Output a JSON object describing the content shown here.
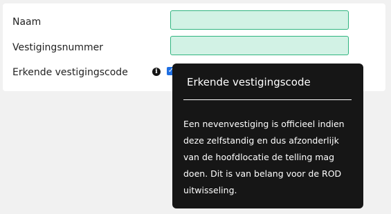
{
  "form": {
    "name_label": "Naam",
    "name_value": "",
    "branch_number_label": "Vestigingsnummer",
    "branch_number_value": "",
    "recognized_code_label": "Erkende vestigingscode",
    "recognized_code_checked": true
  },
  "tooltip": {
    "title": "Erkende vestigingscode",
    "body_lines": [
      "Een nevenvestiging is officieel indien",
      "deze zelfstandig en dus afzonderlijk",
      "van de hoofdlocatie de telling mag",
      "doen. Dit is van belang voor de ROD",
      "uitwisseling."
    ]
  },
  "icons": {
    "info": "info-icon",
    "check": "checkmark-icon"
  },
  "colors": {
    "field_background": "#d2f2e5",
    "field_border": "#2fb47f",
    "checkbox": "#1f6fe2",
    "tooltip_background": "#161616"
  }
}
